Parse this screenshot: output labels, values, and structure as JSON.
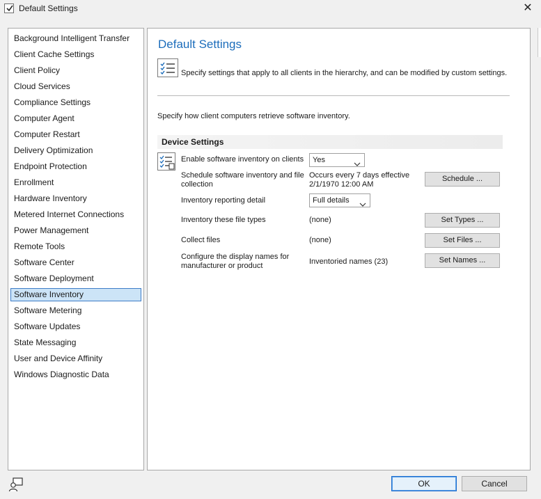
{
  "window": {
    "title": "Default Settings",
    "app_icon": "checklist-icon",
    "close_icon": "close-icon",
    "close_glyph": "✕"
  },
  "sidebar": {
    "selected_index": 16,
    "items": [
      {
        "label": "Background Intelligent Transfer"
      },
      {
        "label": "Client Cache Settings"
      },
      {
        "label": "Client Policy"
      },
      {
        "label": "Cloud Services"
      },
      {
        "label": "Compliance Settings"
      },
      {
        "label": "Computer Agent"
      },
      {
        "label": "Computer Restart"
      },
      {
        "label": "Delivery Optimization"
      },
      {
        "label": "Endpoint Protection"
      },
      {
        "label": "Enrollment"
      },
      {
        "label": "Hardware Inventory"
      },
      {
        "label": "Metered Internet Connections"
      },
      {
        "label": "Power Management"
      },
      {
        "label": "Remote Tools"
      },
      {
        "label": "Software Center"
      },
      {
        "label": "Software Deployment"
      },
      {
        "label": "Software Inventory"
      },
      {
        "label": "Software Metering"
      },
      {
        "label": "Software Updates"
      },
      {
        "label": "State Messaging"
      },
      {
        "label": "User and Device Affinity"
      },
      {
        "label": "Windows Diagnostic Data"
      }
    ]
  },
  "main": {
    "title": "Default Settings",
    "description": "Specify settings that apply to all clients in the hierarchy, and can be modified by custom settings.",
    "subtitle": "Specify how client computers retrieve software inventory.",
    "section_header": "Device Settings",
    "settings": {
      "enable": {
        "label": "Enable software inventory on clients",
        "value": "Yes"
      },
      "schedule": {
        "label_line1": "Schedule software inventory and file",
        "label_line2": "collection",
        "value_line1": "Occurs every 7 days effective",
        "value_line2": "2/1/1970 12:00 AM",
        "button": "Schedule ..."
      },
      "detail": {
        "label": "Inventory reporting detail",
        "value": "Full details"
      },
      "file_types": {
        "label": "Inventory these file types",
        "value": "(none)",
        "button": "Set Types ..."
      },
      "collect": {
        "label": "Collect files",
        "value": "(none)",
        "button": "Set Files ..."
      },
      "names": {
        "label_line1": "Configure the display names for",
        "label_line2": "manufacturer or product",
        "value": "Inventoried names (23)",
        "button": "Set Names ..."
      }
    }
  },
  "footer": {
    "ok": "OK",
    "cancel": "Cancel",
    "help_icon": "user-help-icon"
  },
  "colors": {
    "title_blue": "#1c6dbb",
    "selection_bg": "#cce4f7",
    "selection_border": "#3d7cc7"
  }
}
